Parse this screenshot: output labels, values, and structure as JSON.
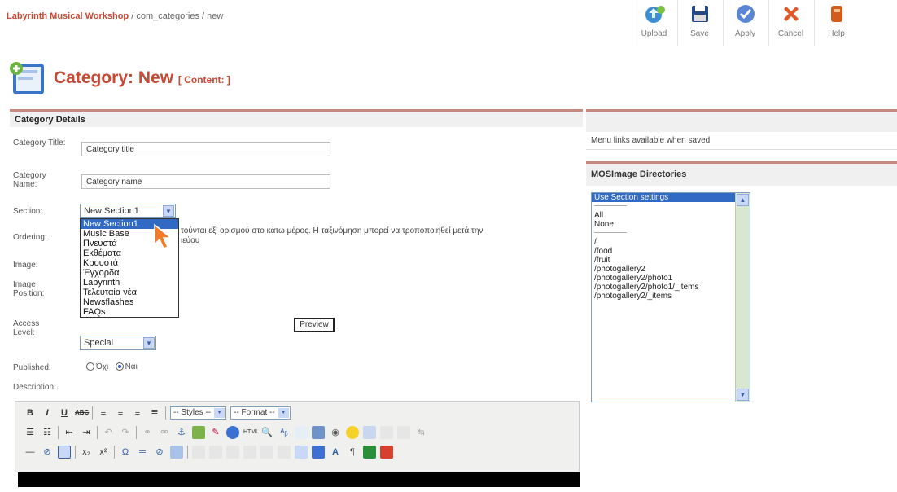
{
  "breadcrumb": {
    "site": "Labyrinth Musical Workshop",
    "path": " / com_categories / new"
  },
  "toolbar": [
    {
      "label": "Upload",
      "icon": "upload-icon",
      "color": "#3b8ed6"
    },
    {
      "label": "Save",
      "icon": "floppy-icon",
      "color": "#234a84"
    },
    {
      "label": "Apply",
      "icon": "check-icon",
      "color": "#5a86d6"
    },
    {
      "label": "Cancel",
      "icon": "cancel-icon",
      "color": "#e2572a"
    },
    {
      "label": "Help",
      "icon": "help-icon",
      "color": "#d35b1c"
    }
  ],
  "page": {
    "title": "Category: New",
    "subtitle": "[ Content: ]"
  },
  "details": {
    "heading": "Category Details",
    "title_label": "Category Title:",
    "title_value": "Category title",
    "name_label": "Category Name:",
    "name_value": "Category name",
    "section_label": "Section:",
    "section_value": "New Section1",
    "section_options": [
      "New Section1",
      "Music Base",
      "Πνευστά",
      "Εκθέματα",
      "Κρουστά",
      "Έγχορδα",
      "Labyrinth",
      "Τελευταία νέα",
      "Newsflashes",
      "FAQs"
    ],
    "ordering_label": "Ordering:",
    "ordering_text_line1": "τούνται εξ' ορισμού στο κάτω μέρος. Η ταξινόμηση μπορεί να τροποποιηθεί μετά την",
    "ordering_text_line2": "ιεύου",
    "image_label": "Image:",
    "image_position_label": "Image Position:",
    "access_label": "Access Level:",
    "access_value": "Special",
    "preview_label": "Preview",
    "published_label": "Published:",
    "published_no": "Όχι",
    "published_yes": "Ναι",
    "description_label": "Description:"
  },
  "editor": {
    "styles_value": "-- Styles --",
    "format_value": "-- Format --"
  },
  "right": {
    "menu_links_text": "Menu links available when saved",
    "mosimage_heading": "MOSImage Directories",
    "directories": [
      "Use Section settings",
      "--------------------",
      "All",
      "None",
      "--------------------",
      "/",
      "/food",
      "/fruit",
      "/photogallery2",
      "/photogallery2/photo1",
      "/photogallery2/photo1/_items",
      "/photogallery2/_items"
    ]
  },
  "colors": {
    "accent": "#c64934",
    "panel_border": "#c88a7f",
    "selection": "#316ac5"
  }
}
